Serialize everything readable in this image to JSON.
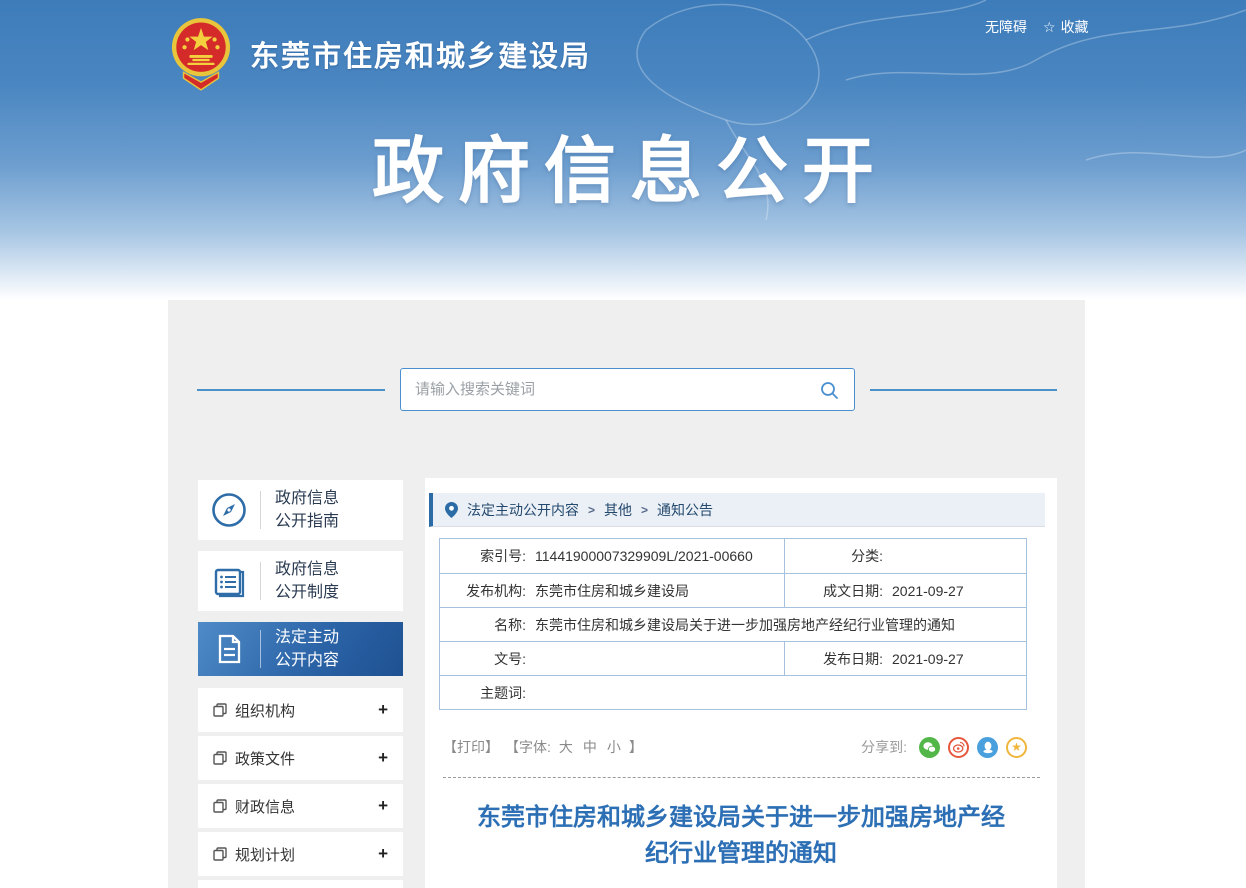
{
  "colors": {
    "header_blue": "#3d7cba",
    "accent_blue": "#2c6ca6",
    "active_item_gradient_start": "#4f8bc7",
    "active_item_gradient_end": "#1e5191",
    "table_border": "#a6c1de",
    "article_title_blue": "#2d6fb5",
    "wechat_green": "#52b648",
    "weibo_red": "#e6573d",
    "qq_blue": "#49a0dc",
    "qzone_yellow": "#f0b63c"
  },
  "header": {
    "site_title": "东莞市住房和城乡建设局",
    "accessibility_link": "无障碍",
    "favorite_link": "收藏",
    "favorite_star_glyph": "☆",
    "banner_title": "政府信息公开"
  },
  "search": {
    "placeholder": "请输入搜索关键词"
  },
  "sidebar": {
    "primary_items": [
      {
        "line1": "政府信息",
        "line2": "公开指南",
        "icon": "compass-icon",
        "active": false
      },
      {
        "line1": "政府信息",
        "line2": "公开制度",
        "icon": "rules-book-icon",
        "active": false
      },
      {
        "line1": "法定主动",
        "line2": "公开内容",
        "icon": "document-icon",
        "active": true
      }
    ],
    "sub_items": [
      {
        "label": "组织机构",
        "expand": "+"
      },
      {
        "label": "政策文件",
        "expand": "+"
      },
      {
        "label": "财政信息",
        "expand": "+"
      },
      {
        "label": "规划计划",
        "expand": "+"
      }
    ]
  },
  "breadcrumb": {
    "separator": ">",
    "items": [
      "法定主动公开内容",
      "其他",
      "通知公告"
    ]
  },
  "doc_meta": {
    "rows": [
      {
        "left": {
          "label": "索引号:",
          "value": "11441900007329909L/2021-00660"
        },
        "right": {
          "label": "分类:",
          "value": ""
        }
      },
      {
        "left": {
          "label": "发布机构:",
          "value": "东莞市住房和城乡建设局"
        },
        "right": {
          "label": "成文日期:",
          "value": "2021-09-27"
        }
      },
      {
        "full": {
          "label": "名称:",
          "value": "东莞市住房和城乡建设局关于进一步加强房地产经纪行业管理的通知"
        }
      },
      {
        "left": {
          "label": "文号:",
          "value": ""
        },
        "right": {
          "label": "发布日期:",
          "value": "2021-09-27"
        }
      },
      {
        "full": {
          "label": "主题词:",
          "value": ""
        }
      }
    ]
  },
  "toolbar": {
    "print_label": "【打印】",
    "font_prefix": "【字体:",
    "font_sizes": [
      "大",
      "中",
      "小"
    ],
    "font_suffix": "】",
    "share_label": "分享到:",
    "qzone_star_glyph": "★"
  },
  "article": {
    "title": "东莞市住房和城乡建设局关于进一步加强房地产经纪行业管理的通知"
  }
}
